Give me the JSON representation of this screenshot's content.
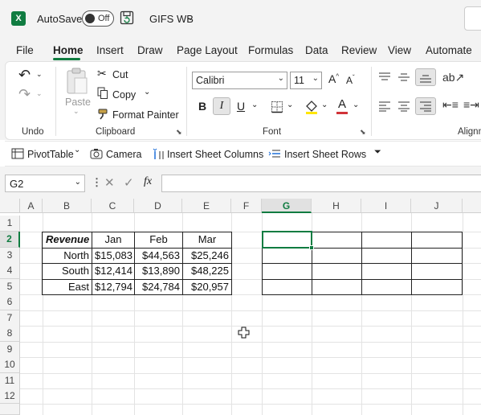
{
  "titlebar": {
    "app_logo": "X",
    "autosave_label": "AutoSave",
    "autosave_state": "Off",
    "workbook_name": "GIFS WB"
  },
  "tabs": [
    "File",
    "Home",
    "Insert",
    "Draw",
    "Page Layout",
    "Formulas",
    "Data",
    "Review",
    "View",
    "Automate"
  ],
  "active_tab": "Home",
  "ribbon": {
    "undo_group": "Undo",
    "clipboard": {
      "label": "Clipboard",
      "paste": "Paste",
      "cut": "Cut",
      "copy": "Copy",
      "format_painter": "Format Painter"
    },
    "font": {
      "label": "Font",
      "font_name": "Calibri",
      "font_size": "11",
      "bold": "B",
      "italic": "I",
      "underline": "U",
      "font_color_letter": "A"
    },
    "alignment": {
      "label": "Alignm"
    }
  },
  "quick_access": {
    "pivot_table": "PivotTable",
    "camera": "Camera",
    "insert_sheet_columns": "Insert Sheet Columns",
    "insert_sheet_rows": "Insert Sheet Rows"
  },
  "formula_bar": {
    "name_box": "G2",
    "fx": "fx",
    "value": ""
  },
  "grid": {
    "columns": [
      "A",
      "B",
      "C",
      "D",
      "E",
      "F",
      "G",
      "H",
      "I",
      "J"
    ],
    "rows": [
      "1",
      "2",
      "3",
      "4",
      "5",
      "6",
      "7",
      "8",
      "9",
      "10",
      "11",
      "12"
    ],
    "selected_cell": "G2",
    "table": {
      "header": [
        "Revenue",
        "Jan",
        "Feb",
        "Mar"
      ],
      "rows": [
        [
          "North",
          "$15,083",
          "$44,563",
          "$25,246"
        ],
        [
          "South",
          "$12,414",
          "$13,890",
          "$48,225"
        ],
        [
          "East",
          "$12,794",
          "$24,784",
          "$20,957"
        ]
      ]
    }
  },
  "colors": {
    "excel_green": "#107c41",
    "font_color_bar": "#d13438"
  }
}
